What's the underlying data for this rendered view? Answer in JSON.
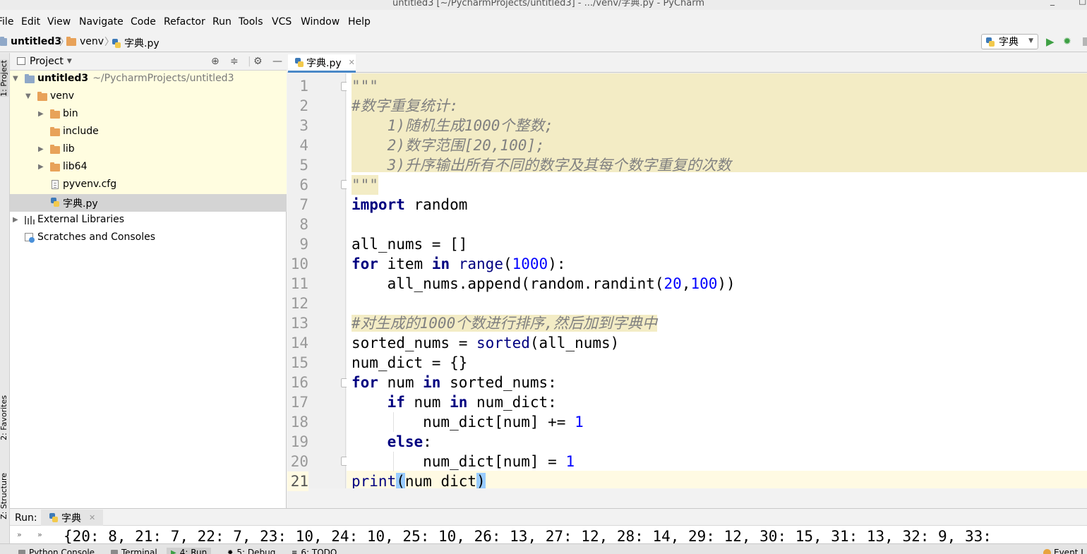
{
  "window": {
    "title": "untitled3 [~/PycharmProjects/untitled3] - .../venv/字典.py - PyCharm"
  },
  "menu": [
    "File",
    "Edit",
    "View",
    "Navigate",
    "Code",
    "Refactor",
    "Run",
    "Tools",
    "VCS",
    "Window",
    "Help"
  ],
  "breadcrumbs": [
    "untitled3",
    "venv",
    "字典.py"
  ],
  "run_config": {
    "name": "字典"
  },
  "left_strip": {
    "project": "1: Project",
    "favorites": "2: Favorites",
    "structure": "Z: Structure"
  },
  "project_panel": {
    "title": "Project",
    "tree": [
      {
        "label": "untitled3",
        "path": "~/PycharmProjects/untitled3"
      },
      {
        "label": "venv"
      },
      {
        "label": "bin"
      },
      {
        "label": "include"
      },
      {
        "label": "lib"
      },
      {
        "label": "lib64"
      },
      {
        "label": "pyvenv.cfg"
      },
      {
        "label": "字典.py"
      },
      {
        "label": "External Libraries"
      },
      {
        "label": "Scratches and Consoles"
      }
    ]
  },
  "editor": {
    "tab_label": "字典.py",
    "line_numbers": [
      "1",
      "2",
      "3",
      "4",
      "5",
      "6",
      "7",
      "8",
      "9",
      "10",
      "11",
      "12",
      "13",
      "14",
      "15",
      "16",
      "17",
      "18",
      "19",
      "20",
      "21"
    ],
    "code": {
      "l1": "\"\"\"",
      "l2": "#数字重复统计:",
      "l3": "    1)随机生成1000个整数;",
      "l4": "    2)数字范围[20,100];",
      "l5": "    3)升序输出所有不同的数字及其每个数字重复的次数",
      "l6": "\"\"\"",
      "l7_kw": "import",
      "l7_rest": " random",
      "l9": "all_nums = []",
      "l10_kw": "for",
      "l10_a": " item ",
      "l10_in": "in",
      "l10_sp": " ",
      "l10_fn": "range",
      "l10_p1": "(",
      "l10_num": "1000",
      "l10_p2": "):",
      "l11_a": "    all_nums.append(random.randint(",
      "l11_n1": "20",
      "l11_c": ",",
      "l11_n2": "100",
      "l11_b": "))",
      "l13": "#对生成的1000个数进行排序,然后加到字典中",
      "l14_a": "sorted_nums = ",
      "l14_fn": "sorted",
      "l14_b": "(all_nums)",
      "l15": "num_dict = {}",
      "l16_kw": "for",
      "l16_a": " num ",
      "l16_in": "in",
      "l16_b": " sorted_nums:",
      "l17_ind": "    ",
      "l17_kw": "if",
      "l17_a": " num ",
      "l17_in": "in",
      "l17_b": " num_dict:",
      "l18_a": "        num_dict[num] += ",
      "l18_n": "1",
      "l19_ind": "    ",
      "l19_kw": "else",
      "l19_b": ":",
      "l20_a": "        num_dict[num] = ",
      "l20_n": "1",
      "l21_fn": "print",
      "l21_p1": "(",
      "l21_a": "num_dict",
      "l21_p2": ")"
    }
  },
  "run_panel": {
    "label": "Run:",
    "tab": "字典",
    "output": "{20: 8, 21: 7, 22: 7, 23: 10, 24: 10, 25: 10, 26: 13, 27: 12, 28: 14, 29: 12, 30: 15, 31: 13, 32: 9, 33:"
  },
  "statusbar": {
    "tabs": [
      "Python Console",
      "Terminal",
      "4: Run",
      "5: Debug",
      "6: TODO"
    ],
    "event_log": "Event L"
  },
  "colors": {
    "keyword": "#000080",
    "number": "#0000ff",
    "comment": "#808080",
    "docstring_bg": "#f3ecc5",
    "selection": "#d4d4d4"
  }
}
